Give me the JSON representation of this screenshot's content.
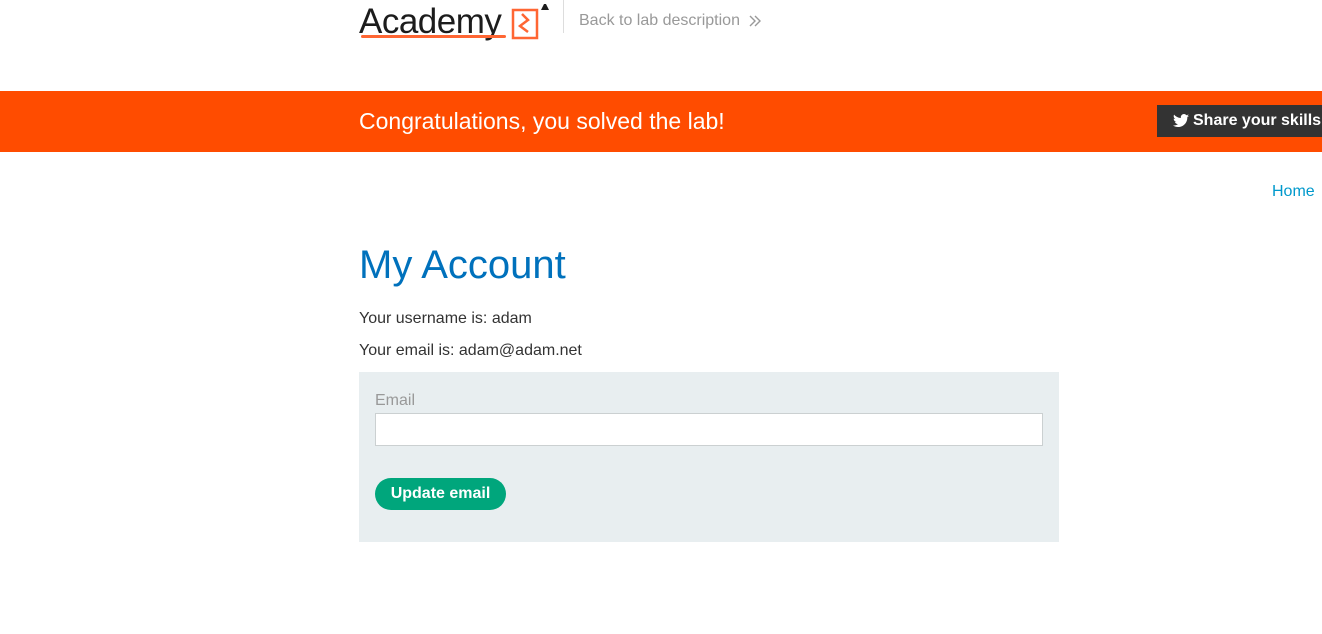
{
  "header": {
    "logo_text": "Academy",
    "back_link": "Back to lab description"
  },
  "banner": {
    "message": "Congratulations, you solved the lab!",
    "share_label": "Share your skills"
  },
  "nav": {
    "home": "Home"
  },
  "main": {
    "title": "My Account",
    "username_line": "Your username is: adam",
    "email_line": "Your email is: adam@adam.net"
  },
  "form": {
    "email_label": "Email",
    "email_value": "",
    "submit_label": "Update email"
  },
  "colors": {
    "banner": "#ff4c00",
    "title": "#0071bc",
    "link": "#0099cc",
    "button": "#00a67c",
    "panel": "#e8eef0"
  },
  "icons": {
    "logo_mark": "academy-logo-mark-icon",
    "back_chevron": "double-chevron-right-icon",
    "share": "twitter-bird-icon"
  }
}
